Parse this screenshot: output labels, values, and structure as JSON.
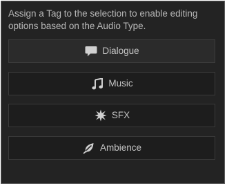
{
  "panel": {
    "instruction": "Assign a Tag to the selection to enable editing options based on the Audio Type.",
    "buttons": [
      {
        "label": "Dialogue",
        "icon": "speech-bubble-icon"
      },
      {
        "label": "Music",
        "icon": "music-note-icon"
      },
      {
        "label": "SFX",
        "icon": "burst-icon"
      },
      {
        "label": "Ambience",
        "icon": "leaf-icon"
      }
    ]
  },
  "colors": {
    "panel_background": "#232323",
    "button_background": "#1d1d1d",
    "text": "#c4c4c4",
    "icon": "#d0d0d0"
  }
}
